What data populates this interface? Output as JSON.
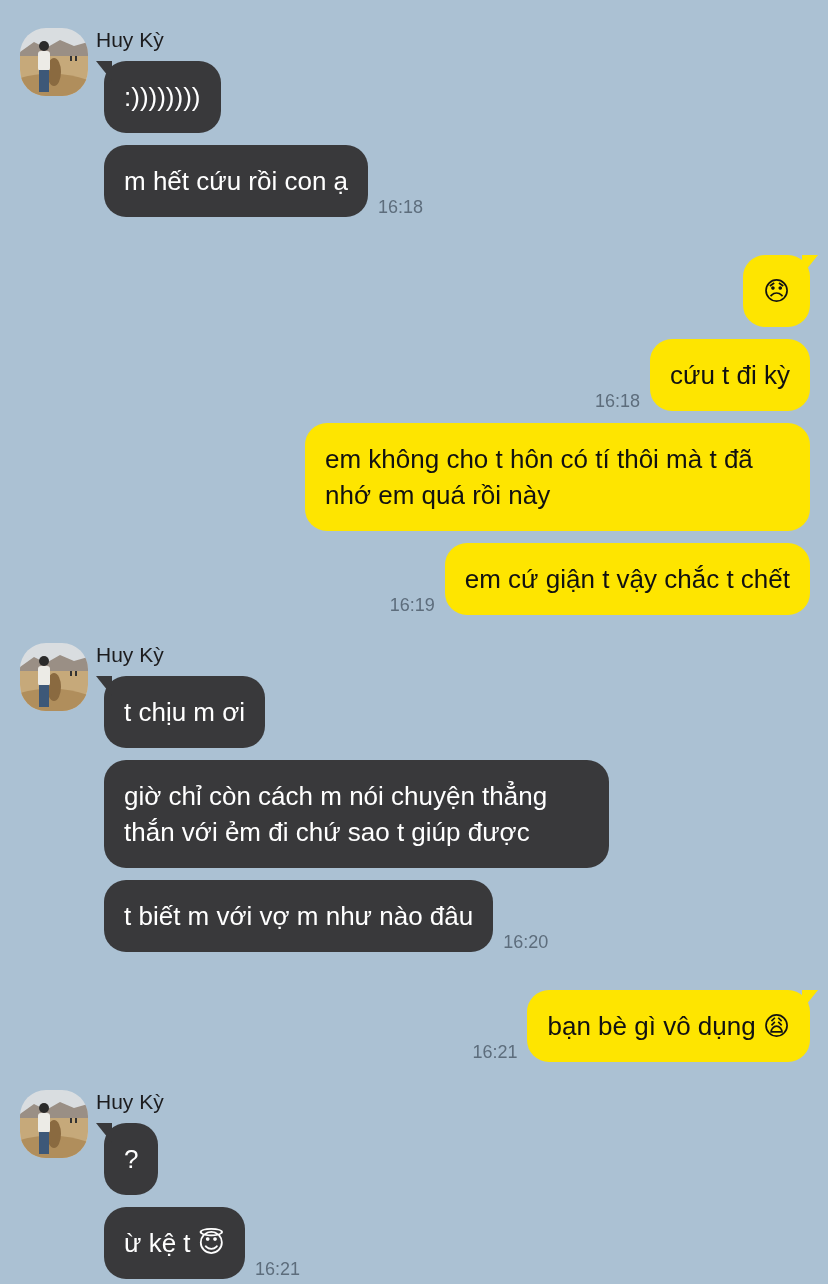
{
  "groups": [
    {
      "outgoing": false,
      "name": "Huy Kỳ",
      "messages": [
        {
          "text": ":))))))))"
        },
        {
          "text": "m hết cứu rồi con ạ",
          "time": "16:18"
        }
      ]
    },
    {
      "outgoing": true,
      "messages": [
        {
          "text": "😞"
        },
        {
          "text": "cứu t đi kỳ",
          "time": "16:18"
        },
        {
          "text": "em không cho t hôn có tí thôi mà t đã nhớ em quá rồi này"
        },
        {
          "text": "em cứ giận t vậy chắc t chết",
          "time": "16:19"
        }
      ]
    },
    {
      "outgoing": false,
      "name": "Huy Kỳ",
      "messages": [
        {
          "text": "t chịu m ơi"
        },
        {
          "text": "giờ chỉ còn cách m nói chuyện thẳng thắn với ẻm đi chứ sao t giúp được"
        },
        {
          "text": "t biết m với vợ m như nào đâu",
          "time": "16:20"
        }
      ]
    },
    {
      "outgoing": true,
      "messages": [
        {
          "text": "bạn bè gì vô dụng 😩",
          "time": "16:21"
        }
      ]
    },
    {
      "outgoing": false,
      "name": "Huy Kỳ",
      "messages": [
        {
          "text": "?"
        },
        {
          "text": "ừ kệ t 😇",
          "time": "16:21"
        }
      ]
    }
  ]
}
